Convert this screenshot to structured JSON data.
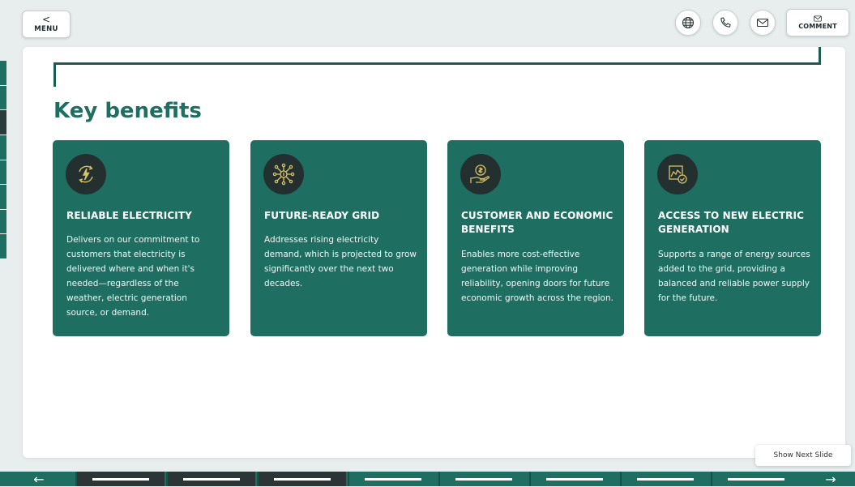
{
  "header": {
    "menu_label": "MENU",
    "menu_chevron": "<",
    "icons": [
      "globe-icon",
      "phone-icon",
      "mail-icon"
    ],
    "comment_label": "COMMENT"
  },
  "slide": {
    "heading": "Key benefits",
    "cards": [
      {
        "icon": "lightning-cycle-icon",
        "title": "RELIABLE ELECTRICITY",
        "description": "Delivers on our commitment to customers that electricity is delivered where and when it's needed—regardless of the weather, electric generation source, or demand."
      },
      {
        "icon": "network-hub-icon",
        "title": "FUTURE-READY GRID",
        "description": "Addresses rising electricity demand, which is projected to grow significantly over the next two decades."
      },
      {
        "icon": "hand-coin-icon",
        "title": "CUSTOMER AND ECONOMIC BENEFITS",
        "description": "Enables more cost-effective generation while improving reliability, opening doors for future economic growth across the region."
      },
      {
        "icon": "map-check-icon",
        "title": "ACCESS TO NEW ELECTRIC GENERATION",
        "description": "Supports a range of energy sources added to the grid, providing a balanced and reliable power supply for the future."
      }
    ]
  },
  "footer": {
    "next_slide_tooltip": "Show Next Slide",
    "prev_arrow": "←",
    "next_arrow": "→",
    "thumbnail_count": 9,
    "colors": {
      "accent": "#1f6e62",
      "dark": "#2b3535"
    }
  }
}
